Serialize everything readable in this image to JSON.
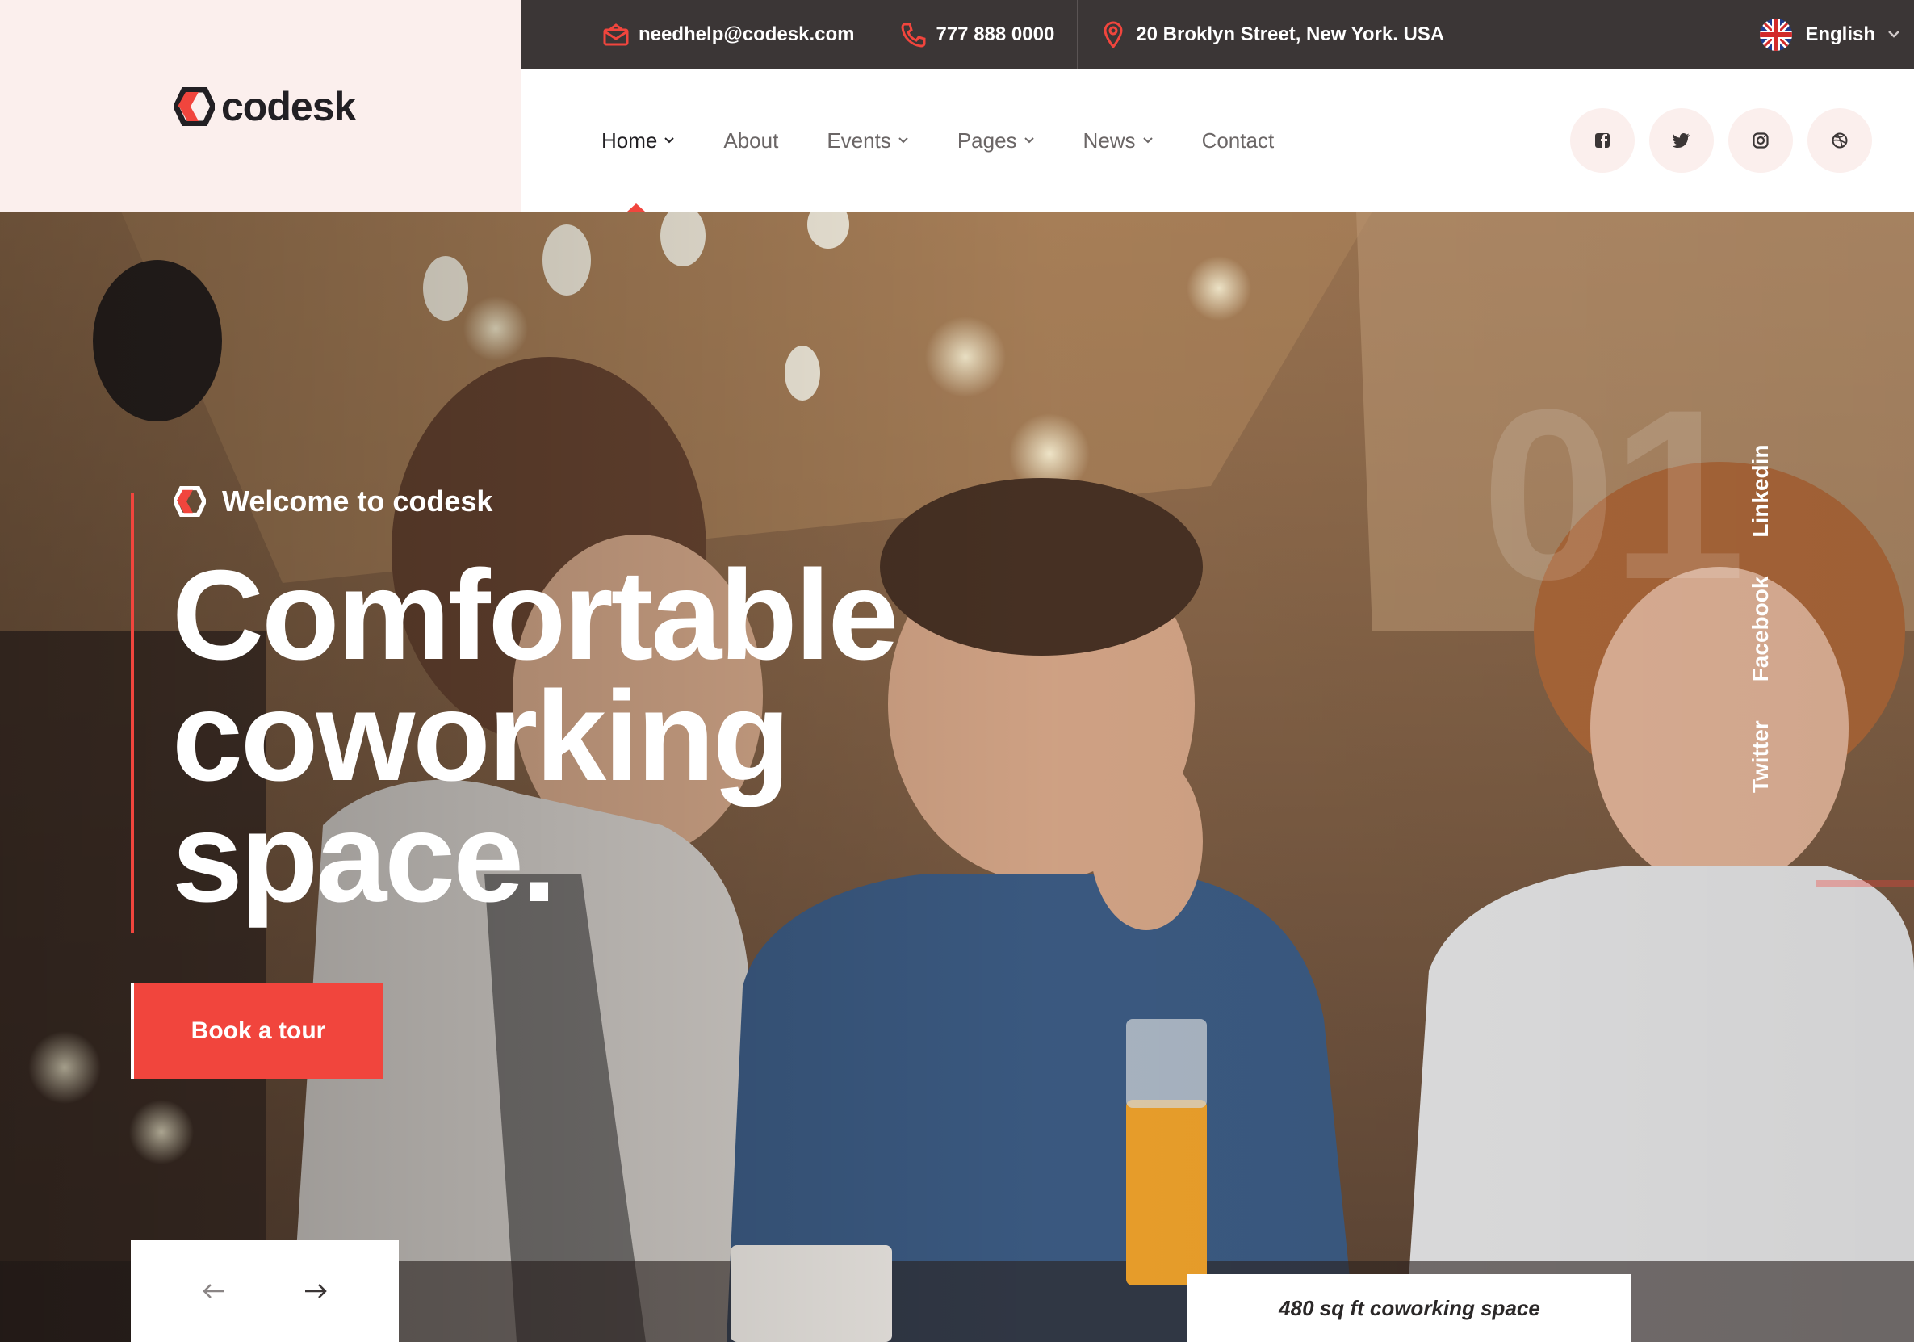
{
  "brand": {
    "name": "codesk",
    "accent": "#f1453d",
    "dark": "#3b3636",
    "logo_icon": "hexagon-logo-icon"
  },
  "topbar": {
    "email": "needhelp@codesk.com",
    "phone": "777 888 0000",
    "address": "20 Broklyn Street, New York. USA",
    "language": "English",
    "icons": {
      "email": "envelope-icon",
      "phone": "phone-icon",
      "address": "map-pin-icon",
      "language": "uk-flag-icon"
    }
  },
  "nav": {
    "items": [
      {
        "label": "Home",
        "has_dropdown": true,
        "active": true
      },
      {
        "label": "About",
        "has_dropdown": false
      },
      {
        "label": "Events",
        "has_dropdown": true
      },
      {
        "label": "Pages",
        "has_dropdown": true
      },
      {
        "label": "News",
        "has_dropdown": true
      },
      {
        "label": "Contact",
        "has_dropdown": false
      }
    ],
    "social_icons": [
      "facebook-icon",
      "twitter-icon",
      "instagram-icon",
      "dribbble-icon"
    ]
  },
  "hero": {
    "slide_number": "01",
    "welcome": "Welcome to codesk",
    "headline": [
      "Comfortable",
      "coworking",
      "space."
    ],
    "cta": "Book a tour",
    "caption": "480 sq ft coworking space",
    "vertical_social": [
      "Twitter",
      "Facebook",
      "Linkedin"
    ],
    "arrows": {
      "prev": "arrow-left-icon",
      "next": "arrow-right-icon"
    }
  }
}
